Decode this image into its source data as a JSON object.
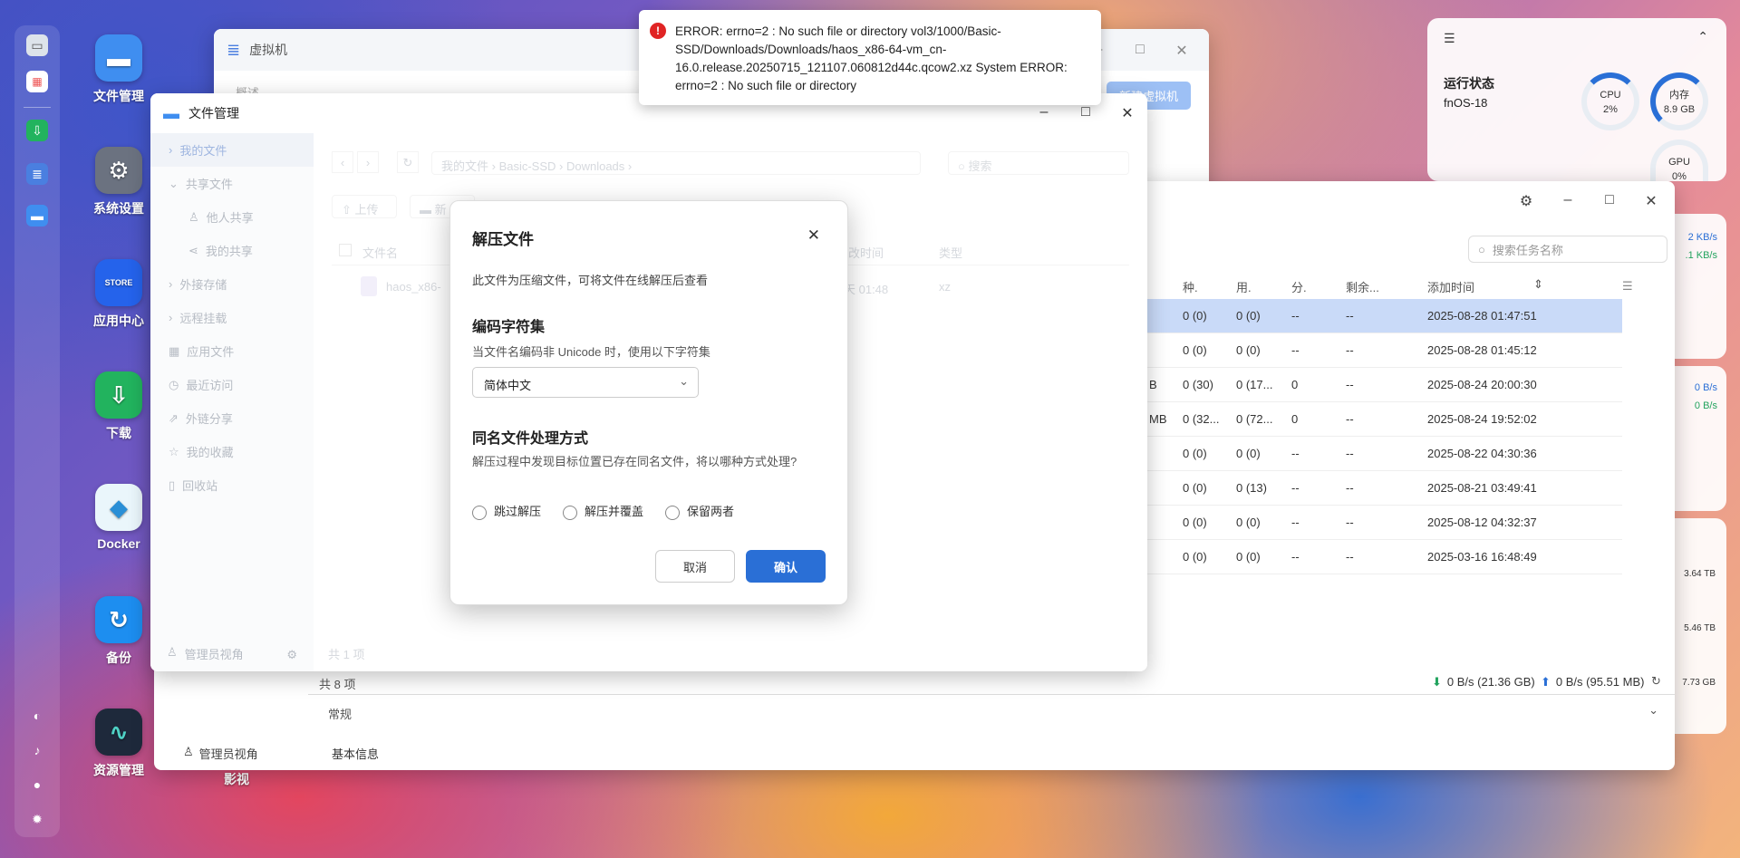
{
  "desktop": {
    "icons": [
      {
        "label": "文件管理",
        "icon": "folder-icon"
      },
      {
        "label": "系统设置",
        "icon": "gear-icon"
      },
      {
        "label": "应用中心",
        "icon": "store-icon",
        "badge": "STORE"
      },
      {
        "label": "下载",
        "icon": "download-icon"
      },
      {
        "label": "Docker",
        "icon": "docker-icon"
      },
      {
        "label": "备份",
        "icon": "backup-icon"
      },
      {
        "label": "资源管理",
        "icon": "monitor-icon"
      },
      {
        "label": "影视",
        "icon": "video-icon"
      }
    ]
  },
  "vm_window": {
    "title": "虚拟机",
    "create_button": "新建虚拟机",
    "nav_item": "概述"
  },
  "file_manager": {
    "title": "文件管理",
    "sidebar": {
      "my_files": "我的文件",
      "shared_files": "共享文件",
      "others_shared": "他人共享",
      "my_shared": "我的共享",
      "external_storage": "外接存储",
      "remote_mount": "远程挂载",
      "app_files": "应用文件",
      "recent": "最近访问",
      "external_share": "外链分享",
      "favorites": "我的收藏",
      "recycle": "回收站",
      "admin_view": "管理员视角"
    },
    "breadcrumb": [
      "我的文件",
      "Basic-SSD",
      "Downloads"
    ],
    "search_placeholder": "搜索",
    "toolbar": {
      "upload": "上传",
      "new": "新"
    },
    "columns": {
      "name": "文件名",
      "mtime": "改时间",
      "type": "类型"
    },
    "file": {
      "name": "haos_x86-",
      "mtime": "天 01:48",
      "type": "xz"
    },
    "footer": "共 1 项"
  },
  "download_window": {
    "search_placeholder": "搜索任务名称",
    "columns": [
      "种.",
      "用.",
      "分.",
      "剩余...",
      "添加时间"
    ],
    "rows": [
      {
        "c0": "",
        "c1": "0 (0)",
        "c2": "0 (0)",
        "c3": "--",
        "c4": "--",
        "added": "2025-08-28 01:47:51"
      },
      {
        "c0": "",
        "c1": "0 (0)",
        "c2": "0 (0)",
        "c3": "--",
        "c4": "--",
        "added": "2025-08-28 01:45:12"
      },
      {
        "c0": "B",
        "c1": "0 (30)",
        "c2": "0 (17...",
        "c3": "0",
        "c4": "--",
        "added": "2025-08-24 20:00:30"
      },
      {
        "c0": "MB",
        "c1": "0 (32...",
        "c2": "0 (72...",
        "c3": "0",
        "c4": "--",
        "added": "2025-08-24 19:52:02"
      },
      {
        "c0": "",
        "c1": "0 (0)",
        "c2": "0 (0)",
        "c3": "--",
        "c4": "--",
        "added": "2025-08-22 04:30:36"
      },
      {
        "c0": "",
        "c1": "0 (0)",
        "c2": "0 (13)",
        "c3": "--",
        "c4": "--",
        "added": "2025-08-21 03:49:41"
      },
      {
        "c0": "",
        "c1": "0 (0)",
        "c2": "0 (0)",
        "c3": "--",
        "c4": "--",
        "added": "2025-08-12 04:32:37"
      },
      {
        "c0": "",
        "c1": "0 (0)",
        "c2": "0 (0)",
        "c3": "--",
        "c4": "--",
        "added": "2025-03-16 16:48:49"
      }
    ],
    "count": "共 8 项",
    "download_speed": "0 B/s (21.36 GB)",
    "upload_speed": "0 B/s (95.51 MB)",
    "section_general": "常规",
    "section_basic": "基本信息",
    "admin_view": "管理员视角"
  },
  "dialog": {
    "title": "解压文件",
    "desc": "此文件为压缩文件，可将文件在线解压后查看",
    "charset_heading": "编码字符集",
    "charset_desc": "当文件名编码非 Unicode 时，使用以下字符集",
    "charset_value": "简体中文",
    "conflict_heading": "同名文件处理方式",
    "conflict_desc": "解压过程中发现目标位置已存在同名文件，将以哪种方式处理?",
    "options": [
      "跳过解压",
      "解压并覆盖",
      "保留两者"
    ],
    "cancel": "取消",
    "confirm": "确认"
  },
  "error_toast": {
    "message": "ERROR: errno=2 : No such file or directory vol3/1000/Basic-SSD/Downloads/Downloads/haos_x86-64-vm_cn-16.0.release.20250715_121107.060812d44c.qcow2.xz System ERROR: errno=2 : No such file or directory"
  },
  "status_widget": {
    "title": "运行状态",
    "host": "fnOS-18",
    "cpu_label": "CPU",
    "cpu_value": "2%",
    "mem_label": "内存",
    "mem_value": "8.9 GB",
    "gpu_label": "GPU",
    "gpu_value": "0%",
    "net1": "2 KB/s",
    "net2": ".1 KB/s",
    "net3": "0 B/s",
    "net4": "0 B/s",
    "disk1": "3.64 TB",
    "disk2": "5.46 TB",
    "disk3": "7.73 GB"
  },
  "colors": {
    "accent": "#2a6fd6",
    "error": "#e02424",
    "selected_row": "#c9daf8"
  }
}
